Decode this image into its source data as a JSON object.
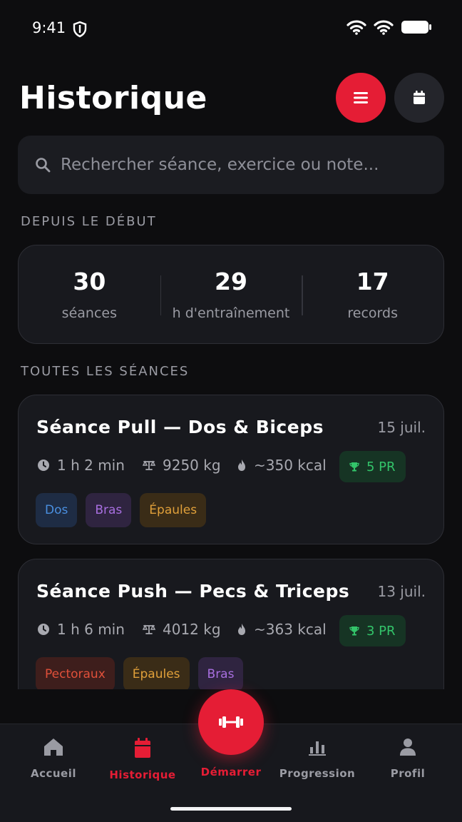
{
  "status_bar": {
    "time": "9:41"
  },
  "header": {
    "title": "Historique"
  },
  "search": {
    "placeholder": "Rechercher séance, exercice ou note..."
  },
  "summary": {
    "section_label": "DEPUIS LE DÉBUT",
    "stats": [
      {
        "value": "30",
        "label": "séances"
      },
      {
        "value": "29",
        "label": "h d'entraînement"
      },
      {
        "value": "17",
        "label": "records"
      }
    ]
  },
  "sessions": {
    "section_label": "TOUTES LES SÉANCES",
    "items": [
      {
        "title": "Séance Pull — Dos & Biceps",
        "date": "15 juil.",
        "duration": "1 h 2 min",
        "volume": "9250 kg",
        "calories": "~350 kcal",
        "pr": "5 PR",
        "tags": [
          {
            "label": "Dos",
            "color": "#4a8fe0"
          },
          {
            "label": "Bras",
            "color": "#a86fe0"
          },
          {
            "label": "Épaules",
            "color": "#e0a03a"
          }
        ]
      },
      {
        "title": "Séance Push — Pecs & Triceps",
        "date": "13 juil.",
        "duration": "1 h 6 min",
        "volume": "4012 kg",
        "calories": "~363 kcal",
        "pr": "3 PR",
        "tags": [
          {
            "label": "Pectoraux",
            "color": "#e0503a"
          },
          {
            "label": "Épaules",
            "color": "#e0a03a"
          },
          {
            "label": "Bras",
            "color": "#a86fe0"
          }
        ]
      }
    ]
  },
  "nav": {
    "items": [
      {
        "label": "Accueil",
        "icon": "home-icon"
      },
      {
        "label": "Historique",
        "icon": "calendar-icon",
        "active": true
      },
      {
        "label": "Démarrer",
        "icon": "dumbbell-icon"
      },
      {
        "label": "Progression",
        "icon": "bar-chart-icon"
      },
      {
        "label": "Profil",
        "icon": "user-icon"
      }
    ]
  },
  "colors": {
    "accent": "#e51d35",
    "background": "#0d0d0f",
    "card": "#18191e",
    "pr_green": "#33c46a"
  }
}
